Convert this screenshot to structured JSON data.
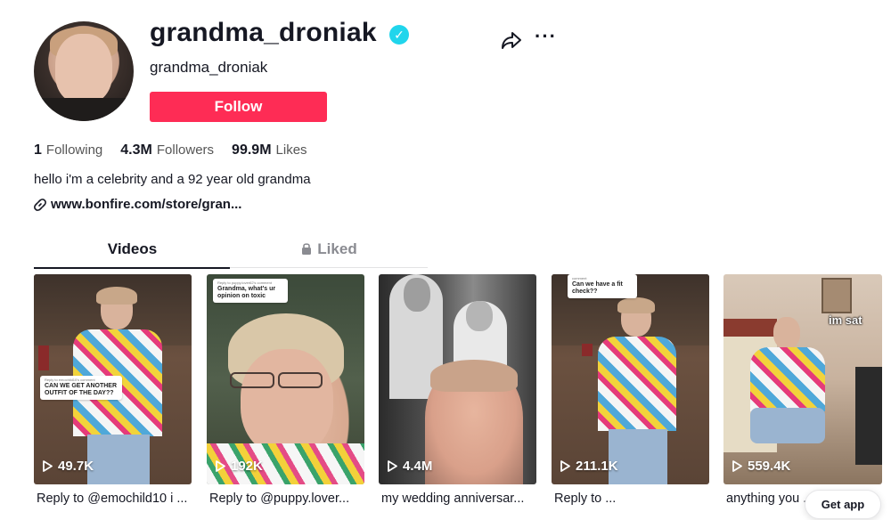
{
  "profile": {
    "username": "grandma_droniak",
    "nickname": "grandma_droniak",
    "verified_icon": "check-badge",
    "follow_label": "Follow",
    "stats": [
      {
        "value": "1",
        "label": "Following"
      },
      {
        "value": "4.3M",
        "label": "Followers"
      },
      {
        "value": "99.9M",
        "label": "Likes"
      }
    ],
    "bio": "hello i'm a celebrity and a 92 year old grandma",
    "link": "www.bonfire.com/store/gran..."
  },
  "tabs": [
    {
      "label": "Videos",
      "active": true
    },
    {
      "label": "Liked",
      "active": false,
      "icon": "lock-icon"
    }
  ],
  "videos": [
    {
      "views": "49.7K",
      "caption": "Reply to @emochild10 i ...",
      "bubble": "CAN WE GET ANOTHER OUTFIT OF THE DAY??",
      "bubble_reply": "Reply to emochild10's comment"
    },
    {
      "views": "192K",
      "caption": "Reply to @puppy.lover...",
      "bubble": "Grandma, what's ur opinion on toxic",
      "bubble_reply": "Reply to puppy.lover62's comment"
    },
    {
      "views": "4.4M",
      "caption": "my wedding anniversar..."
    },
    {
      "views": "211.1K",
      "caption": "Reply to ...",
      "bubble": "Can we have a fit check??",
      "bubble_reply": "comment"
    },
    {
      "views": "559.4K",
      "caption": "anything you ...",
      "overlay_text": "im sat"
    }
  ],
  "get_app_label": "Get app",
  "colors": {
    "accent": "#fe2c55",
    "verified": "#20d5ec",
    "text": "#161823",
    "muted": "#8a8b91"
  }
}
